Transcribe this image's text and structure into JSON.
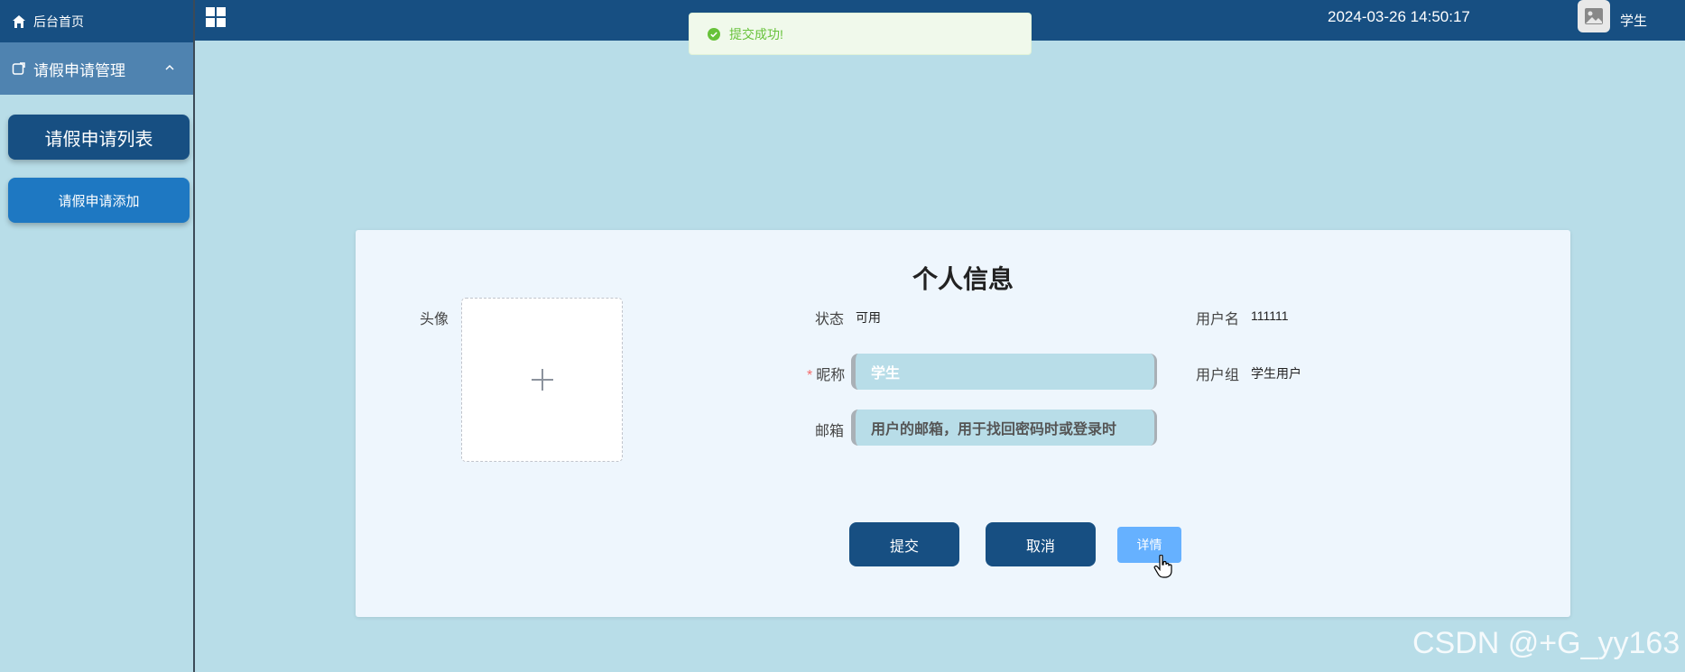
{
  "sidebar": {
    "home_label": "后台首页",
    "group_label": "请假申请管理",
    "items": [
      {
        "label": "请假申请列表"
      },
      {
        "label": "请假申请添加"
      }
    ]
  },
  "topbar": {
    "title": "",
    "datetime": "2024-03-26 14:50:17",
    "user_name": "学生"
  },
  "toast": {
    "message": "提交成功!"
  },
  "profile": {
    "title": "个人信息",
    "avatar_label": "头像",
    "status_label": "状态",
    "status_value": "可用",
    "username_label": "用户名",
    "username_value": "111111",
    "nickname_label": "昵称",
    "nickname_value": "学生",
    "usergroup_label": "用户组",
    "usergroup_value": "学生用户",
    "email_label": "邮箱",
    "email_placeholder": "用户的邮箱，用于找回密码时或登录时",
    "buttons": {
      "submit": "提交",
      "cancel": "取消",
      "detail": "详情"
    }
  },
  "watermark": "CSDN @+G_yy163",
  "colors": {
    "primary": "#174f82",
    "background": "#b8dde8",
    "card": "#eef6fd",
    "success": "#67c23a"
  }
}
